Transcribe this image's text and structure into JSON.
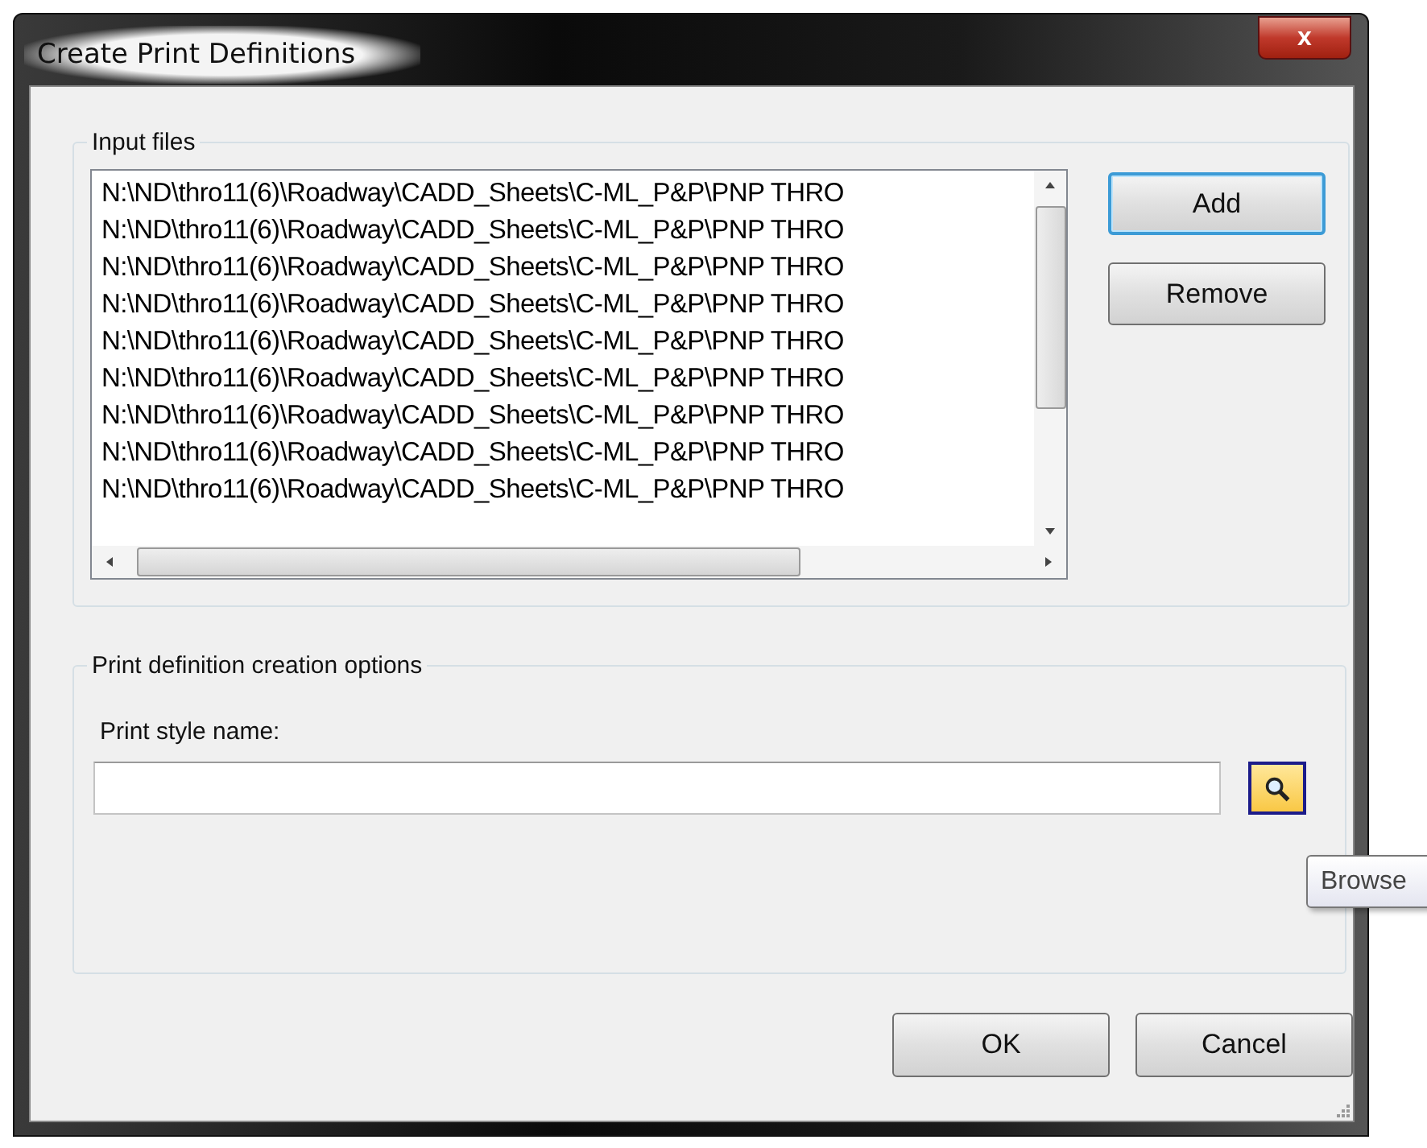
{
  "window": {
    "title": "Create Print Definitions",
    "close": "x"
  },
  "input_files": {
    "title": "Input files",
    "rows": [
      {
        "text": "N:\\ND\\thro11(6)\\Roadway\\CADD_Sheets\\C-ML_P&P\\PNP THRO"
      },
      {
        "text": "N:\\ND\\thro11(6)\\Roadway\\CADD_Sheets\\C-ML_P&P\\PNP THRO"
      },
      {
        "text": "N:\\ND\\thro11(6)\\Roadway\\CADD_Sheets\\C-ML_P&P\\PNP THRO"
      },
      {
        "text": "N:\\ND\\thro11(6)\\Roadway\\CADD_Sheets\\C-ML_P&P\\PNP THRO"
      },
      {
        "text": "N:\\ND\\thro11(6)\\Roadway\\CADD_Sheets\\C-ML_P&P\\PNP THRO"
      },
      {
        "text": "N:\\ND\\thro11(6)\\Roadway\\CADD_Sheets\\C-ML_P&P\\PNP THRO"
      },
      {
        "text": "N:\\ND\\thro11(6)\\Roadway\\CADD_Sheets\\C-ML_P&P\\PNP THRO"
      },
      {
        "text": "N:\\ND\\thro11(6)\\Roadway\\CADD_Sheets\\C-ML_P&P\\PNP THRO"
      },
      {
        "text": "N:\\ND\\thro11(6)\\Roadway\\CADD_Sheets\\C-ML_P&P\\PNP THRO"
      }
    ],
    "buttons": [
      {
        "label": "Add",
        "focused": true
      },
      {
        "label": "Remove",
        "focused": false
      }
    ]
  },
  "options": {
    "title": "Print definition creation options",
    "field_label": "Print style name:",
    "tooltip": "Browse"
  },
  "buttons": [
    "OK",
    "Cancel"
  ]
}
